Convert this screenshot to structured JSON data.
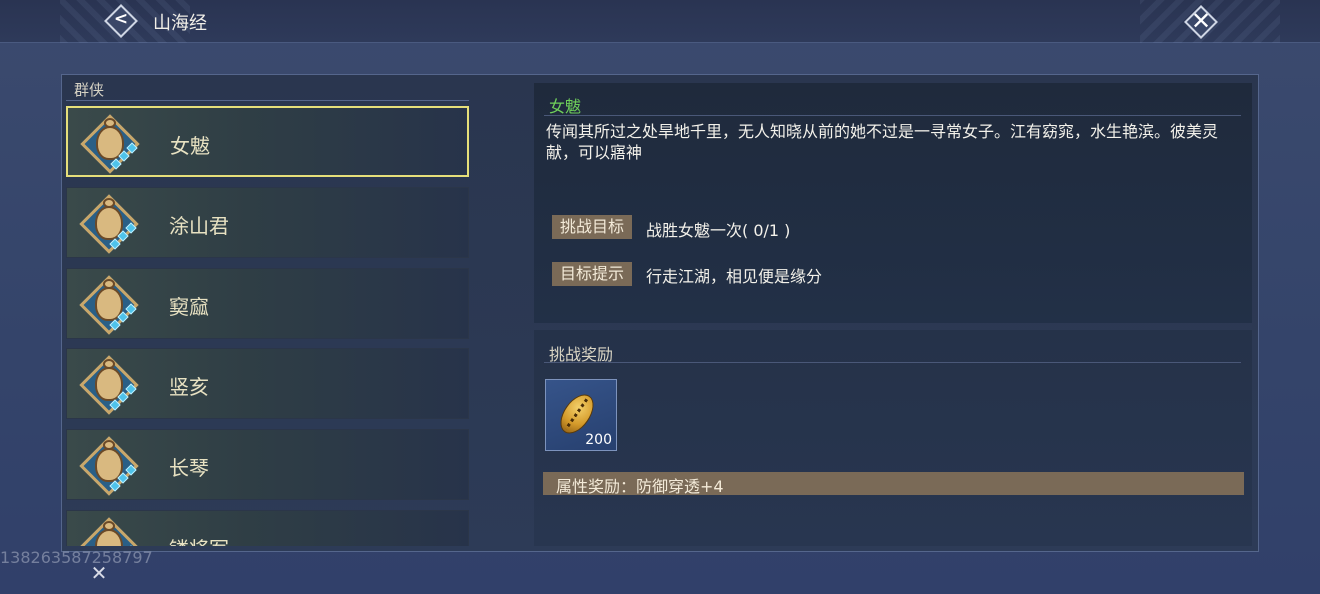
{
  "header": {
    "title": "山海经"
  },
  "list": {
    "header": "群侠",
    "items": [
      {
        "label": "女魃",
        "selected": true
      },
      {
        "label": "涂山君",
        "selected": false
      },
      {
        "label": "窫窳",
        "selected": false
      },
      {
        "label": "竖亥",
        "selected": false
      },
      {
        "label": "长琴",
        "selected": false
      },
      {
        "label": "镂将军",
        "selected": false
      }
    ]
  },
  "detail": {
    "name": "女魃",
    "description": "传闻其所过之处旱地千里，无人知晓从前的她不过是一寻常女子。江有窈窕，水生艳滨。彼美灵献，可以寤神",
    "challenge_label": "挑战目标",
    "challenge_value": "战胜女魃一次( 0/1 )",
    "hint_label": "目标提示",
    "hint_value": "行走江湖，相见便是缘分"
  },
  "reward": {
    "title": "挑战奖励",
    "item_count": "200",
    "item_icon": "golden-seed-icon",
    "attribute_text": "属性奖励：防御穿透+4"
  },
  "watermark": "13826358725879​7",
  "colors": {
    "selected_border": "#e6df7a",
    "name_green": "#6fd05a",
    "tag_bg": "#7a6a57"
  }
}
